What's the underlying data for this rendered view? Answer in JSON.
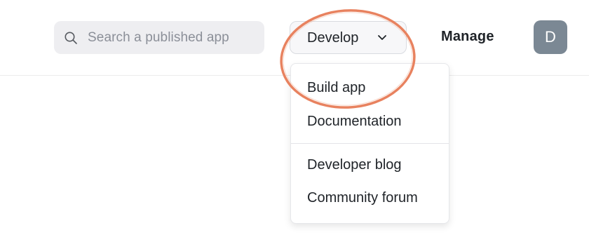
{
  "header": {
    "search": {
      "placeholder": "Search a published app",
      "icon": "search-icon"
    },
    "develop_button": {
      "label": "Develop",
      "icon": "chevron-down-icon"
    },
    "manage_label": "Manage",
    "avatar_initial": "D"
  },
  "develop_menu": {
    "group_1": [
      {
        "label": "Build app"
      },
      {
        "label": "Documentation"
      }
    ],
    "group_2": [
      {
        "label": "Developer blog"
      },
      {
        "label": "Community forum"
      }
    ]
  },
  "colors": {
    "highlight_ring": "#e8825f",
    "avatar_bg": "#7b8894",
    "search_bg": "#eeeef1"
  }
}
